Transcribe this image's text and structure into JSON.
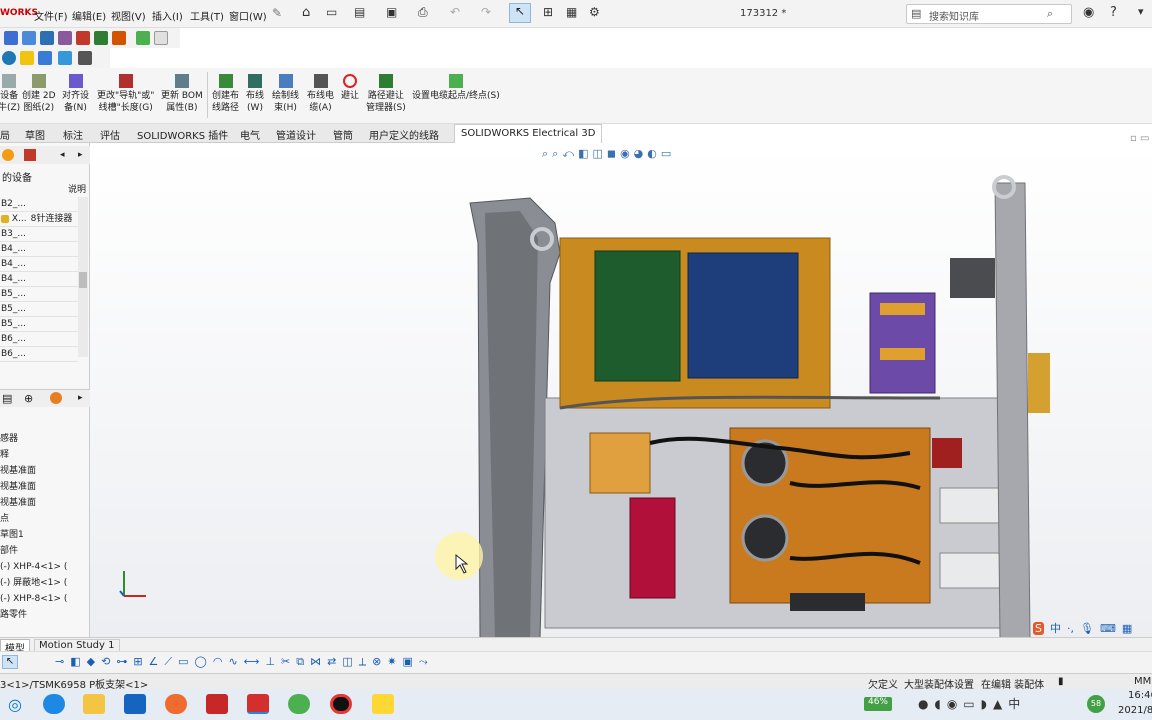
{
  "app": {
    "logo_text": "WORKS",
    "document_title": "173312 *"
  },
  "menu": [
    "文件(F)",
    "编辑(E)",
    "视图(V)",
    "插入(I)",
    "工具(T)",
    "窗口(W)"
  ],
  "search": {
    "placeholder": "搜索知识库"
  },
  "command_manager": [
    {
      "line1": "设备",
      "line2": "牛(Z)"
    },
    {
      "line1": "创建 2D",
      "line2": "图纸(2)"
    },
    {
      "line1": "对齐设",
      "line2": "备(N)"
    },
    {
      "line1": "更改\"导轨\"或\"",
      "line2": "线槽\"长度(G)"
    },
    {
      "line1": "更新 BOM",
      "line2": "属性(B)"
    },
    {
      "line1": "创建布",
      "line2": "线路径"
    },
    {
      "line1": "布线",
      "line2": "(W)"
    },
    {
      "line1": "绘制线",
      "line2": "束(H)"
    },
    {
      "line1": "布线电",
      "line2": "缆(A)"
    },
    {
      "line1": "避让",
      "line2": ""
    },
    {
      "line1": "路径避让",
      "line2": "管理器(S)"
    },
    {
      "line1": "设置电缆起点/终点(S)",
      "line2": ""
    }
  ],
  "tabs": [
    "局",
    "草图",
    "标注",
    "评估",
    "SOLIDWORKS 插件",
    "电气",
    "管道设计",
    "管筒",
    "用户定义的线路",
    "SOLIDWORKS Electrical 3D"
  ],
  "active_tab": "SOLIDWORKS Electrical 3D",
  "left_panel": {
    "header": "的设备",
    "column_desc": "说明",
    "rows": [
      {
        "id": "B2_...",
        "desc": ""
      },
      {
        "id": "X...",
        "desc": "8针连接器"
      },
      {
        "id": "B3_...",
        "desc": ""
      },
      {
        "id": "B4_...",
        "desc": ""
      },
      {
        "id": "B4_...",
        "desc": ""
      },
      {
        "id": "B4_...",
        "desc": ""
      },
      {
        "id": "B5_...",
        "desc": ""
      },
      {
        "id": "B5_...",
        "desc": ""
      },
      {
        "id": "B5_...",
        "desc": ""
      },
      {
        "id": "B6_...",
        "desc": ""
      },
      {
        "id": "B6_...",
        "desc": ""
      }
    ],
    "tree": [
      "感器",
      "释",
      "视基准面",
      "视基准面",
      "视基准面",
      "点",
      "草图1",
      "部件",
      "(-) XHP-4<1> (",
      "(-) 屏蔽地<1> (",
      "(-) XHP-8<1> (",
      "路零件"
    ]
  },
  "bottom_tabs": [
    "模型",
    "Motion Study 1"
  ],
  "status": {
    "path": "3<1>/TSMK6958 P板支架<1>",
    "under_defined": "欠定义",
    "mode": "大型装配体设置",
    "editing": "在编辑 装配体",
    "units": "MM"
  },
  "taskbar": {
    "battery": "46%",
    "time": "16:46",
    "date": "2021/8"
  },
  "ime": [
    "中",
    "·,"
  ],
  "colors": {
    "accent": "#1a5fb4",
    "panel": "#f7f7f7",
    "board_green": "#1e5c2e",
    "board_blue": "#1d3e7a",
    "frame_orange": "#c98a1f",
    "relay_purple": "#6b4aa8"
  }
}
